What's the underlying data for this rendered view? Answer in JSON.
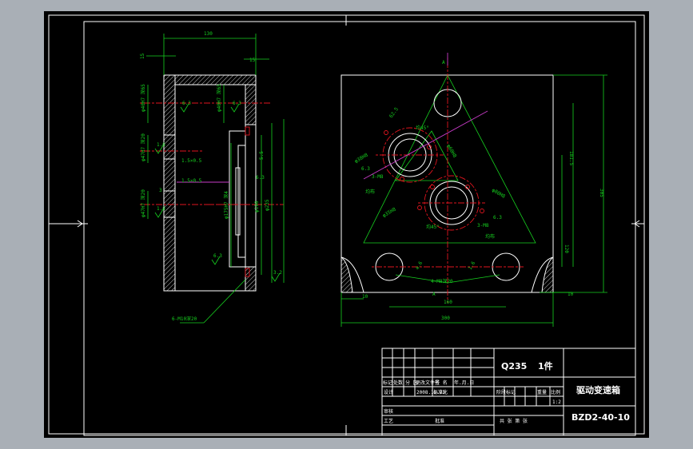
{
  "drawing": {
    "material": "Q235",
    "quantity": "1件",
    "part_name": "驱动变速箱",
    "drawing_number": "BZD2-40-10",
    "scale": "1:2"
  },
  "title_block": {
    "rev_headers": [
      "标记",
      "处数",
      "分 区",
      "更改文件号",
      "签 名",
      "年.月.日"
    ],
    "row_design": [
      "设计",
      "2008.12.22",
      "标准化"
    ],
    "stage_headers": [
      "阶段标记",
      "重量",
      "比例"
    ],
    "review": "审核",
    "process": "工艺",
    "approve": "批准",
    "sheets": "共  张 第  张"
  },
  "side_view": {
    "dims": {
      "overall": "130",
      "right_wall": "15",
      "left_wall": "15",
      "bore_top": "φ40H7 深65",
      "bore_mid_1": "φ47H7 深20",
      "bore_mid_2": "φ47H7 深20",
      "thread_1": "1.5×0.5",
      "thread_2": "1.5×0.5",
      "shaft_a": "φ175H7 深4",
      "shaft_b": "φ190",
      "shaft_c": "φ235",
      "slot": "5.5",
      "depth": "6.3",
      "bolt": "6-M10深20"
    },
    "rough": [
      "6.3",
      "6.3",
      "1.6",
      "1.6",
      "3",
      "3",
      "6.3",
      "6.3",
      "3.2",
      "3.2"
    ]
  },
  "front_view": {
    "dims": {
      "width": "300",
      "height": "305",
      "center_gap": "160",
      "edge_left": "10",
      "edge_right": "10",
      "right_1": "181.5",
      "right_2": "120",
      "bottom_left": "18",
      "label_a_top": "A",
      "label_a_bot": "A",
      "d1": "φ60H8",
      "d2": "φ80H8",
      "d3": "φ38H8",
      "d4": "φ38H8",
      "d5": "φ35H8",
      "d6": "φ38H8",
      "d7": "φ38H8",
      "ang1": "均45°",
      "ang2": "均45°",
      "ang3": "120°",
      "holes1": "3-M8",
      "holes2": "3-M8",
      "even1": "均布",
      "even2": "均布",
      "num1": "62.5",
      "num2": "4.6",
      "num3": "1.6",
      "num4": "1.6",
      "num5": "6.3",
      "num6": "6.3",
      "tag": "4-M8深20"
    }
  }
}
